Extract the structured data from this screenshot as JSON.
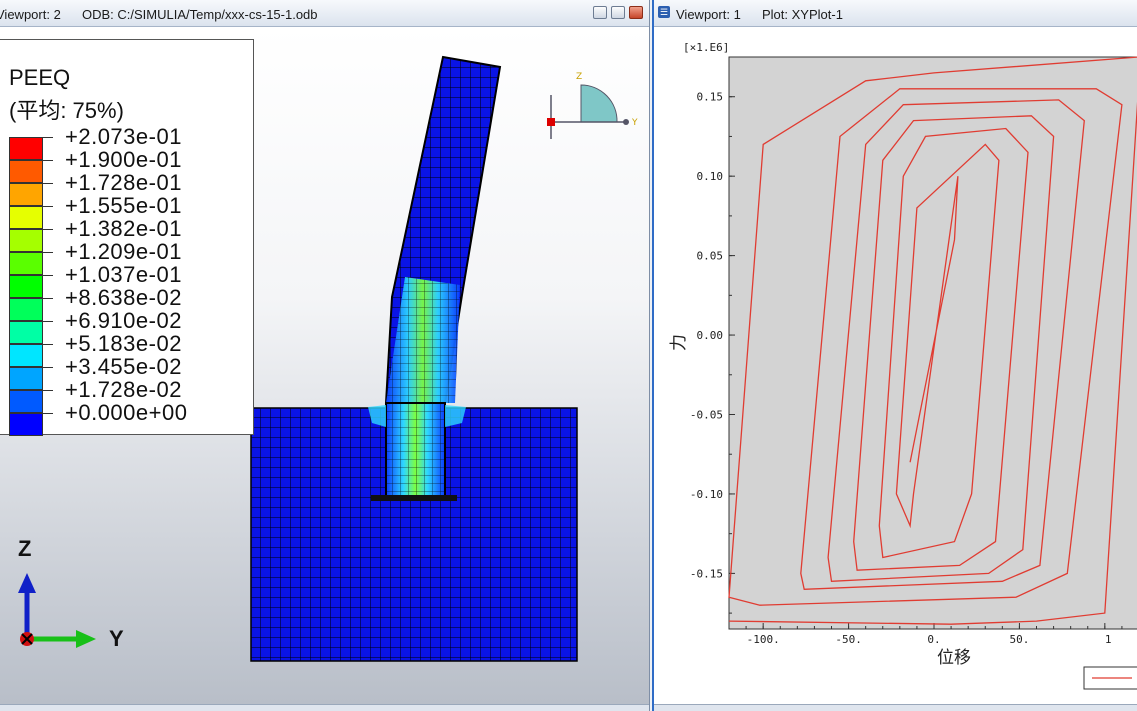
{
  "left_viewport": {
    "title": "Viewport: 2",
    "odb": "ODB: C:/SIMULIA/Temp/xxx-cs-15-1.odb",
    "legend": {
      "title": "PEEQ",
      "subtitle": "(平均: 75%)",
      "entries": [
        "+2.073e-01",
        "+1.900e-01",
        "+1.728e-01",
        "+1.555e-01",
        "+1.382e-01",
        "+1.209e-01",
        "+1.037e-01",
        "+8.638e-02",
        "+6.910e-02",
        "+5.183e-02",
        "+3.455e-02",
        "+1.728e-02",
        "+0.000e+00"
      ],
      "colors": [
        "#ff0000",
        "#ff5a00",
        "#ffa500",
        "#e6ff00",
        "#a5ff00",
        "#5aff00",
        "#00ff00",
        "#00ff5a",
        "#00ffa5",
        "#00e6ff",
        "#00a5ff",
        "#005aff",
        "#0000ff"
      ]
    },
    "triad": {
      "z": "Z",
      "y": "Y"
    },
    "mini_triad": {
      "z": "Z",
      "y": "Y"
    }
  },
  "right_viewport": {
    "title": "Viewport: 1",
    "plot": "Plot: XYPlot-1",
    "exponent_label": "[×1.E6]",
    "ylabel": "力",
    "xlabel": "位移"
  },
  "chart_data": {
    "type": "line",
    "xlabel": "位移",
    "ylabel": "力",
    "y_multiplier": "×1.E6",
    "xlim": [
      -120,
      120
    ],
    "ylim": [
      -0.185,
      0.175
    ],
    "xticks": [
      "-100.",
      "-50.",
      "0.",
      "50.",
      "1"
    ],
    "yticks": [
      "0.15",
      "0.10",
      "0.05",
      "0.00",
      "-0.05",
      "-0.10",
      "-0.15"
    ],
    "grid": false,
    "series": [
      {
        "color": "#e03c32",
        "x": [
          -14,
          12,
          14,
          -12,
          -14,
          -22,
          -10,
          30,
          38,
          22,
          12,
          -30,
          -32,
          -18,
          -5,
          42,
          55,
          36,
          15,
          -45,
          -47,
          -30,
          -12,
          57,
          70,
          52,
          32,
          -60,
          -62,
          -40,
          -18,
          73,
          88,
          62,
          40,
          -76,
          -78,
          -55,
          -20,
          95,
          110,
          78,
          48,
          -102,
          -120,
          -100,
          -40,
          0,
          150,
          180,
          150,
          100,
          60,
          10,
          -120
        ],
        "y": [
          -0.08,
          0.06,
          0.1,
          -0.1,
          -0.12,
          -0.1,
          0.08,
          0.12,
          0.11,
          -0.1,
          -0.13,
          -0.14,
          -0.12,
          0.1,
          0.125,
          0.13,
          0.115,
          -0.13,
          -0.145,
          -0.148,
          -0.13,
          0.11,
          0.135,
          0.138,
          0.125,
          -0.135,
          -0.15,
          -0.155,
          -0.14,
          0.12,
          0.145,
          0.148,
          0.135,
          -0.145,
          -0.155,
          -0.16,
          -0.15,
          0.125,
          0.155,
          0.155,
          0.145,
          -0.15,
          -0.165,
          -0.17,
          -0.165,
          0.12,
          0.16,
          0.165,
          0.175,
          0.17,
          0.16,
          -0.175,
          -0.18,
          -0.182,
          -0.18
        ]
      }
    ]
  }
}
